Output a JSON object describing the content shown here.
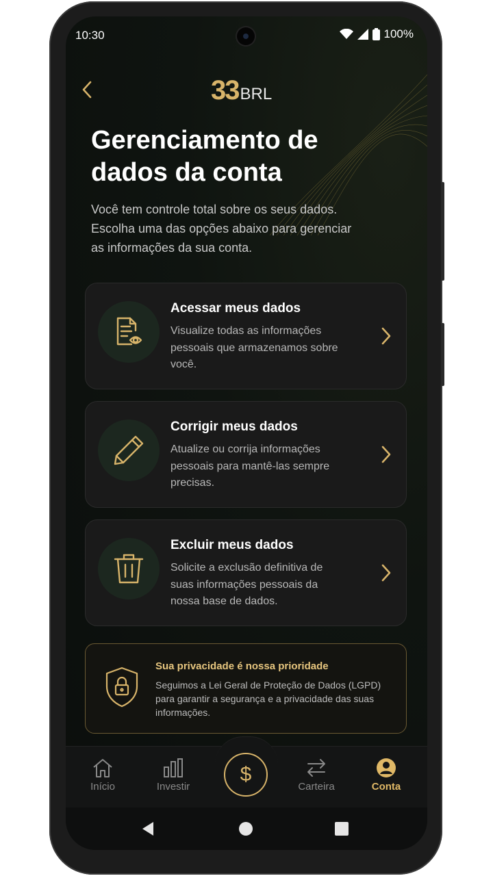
{
  "status_bar": {
    "time": "10:30",
    "battery": "100%"
  },
  "brand": {
    "number": "33",
    "currency": "BRL",
    "color": "#d8b46a"
  },
  "header": {
    "title": "Gerenciamento de dados da conta",
    "subtitle": "Você tem controle total sobre os seus dados. Escolha uma das opções abaixo para gerenciar as informações da sua conta."
  },
  "options": [
    {
      "title": "Acessar meus dados",
      "description": "Visualize todas as informações pessoais que armazenamos sobre você.",
      "icon": "document-eye-icon"
    },
    {
      "title": "Corrigir meus dados",
      "description": "Atualize ou corrija informações pessoais para mantê-las sempre precisas.",
      "icon": "pencil-icon"
    },
    {
      "title": "Excluir meus dados",
      "description": "Solicite a exclusão definitiva de suas informações pessoais da nossa base de dados.",
      "icon": "trash-icon"
    }
  ],
  "privacy": {
    "title": "Sua privacidade é nossa prioridade",
    "text": "Seguimos a Lei Geral de Proteção de Dados (LGPD) para garantir a segurança e a privacidade das suas informações.",
    "icon": "shield-lock-icon"
  },
  "bottom_nav": {
    "items": [
      {
        "label": "Início",
        "icon": "home-icon"
      },
      {
        "label": "Investir",
        "icon": "bar-chart-icon"
      },
      {
        "label": "Carteira",
        "icon": "transfer-icon"
      },
      {
        "label": "Conta",
        "icon": "user-icon",
        "active": true
      }
    ],
    "center_symbol": "$"
  }
}
